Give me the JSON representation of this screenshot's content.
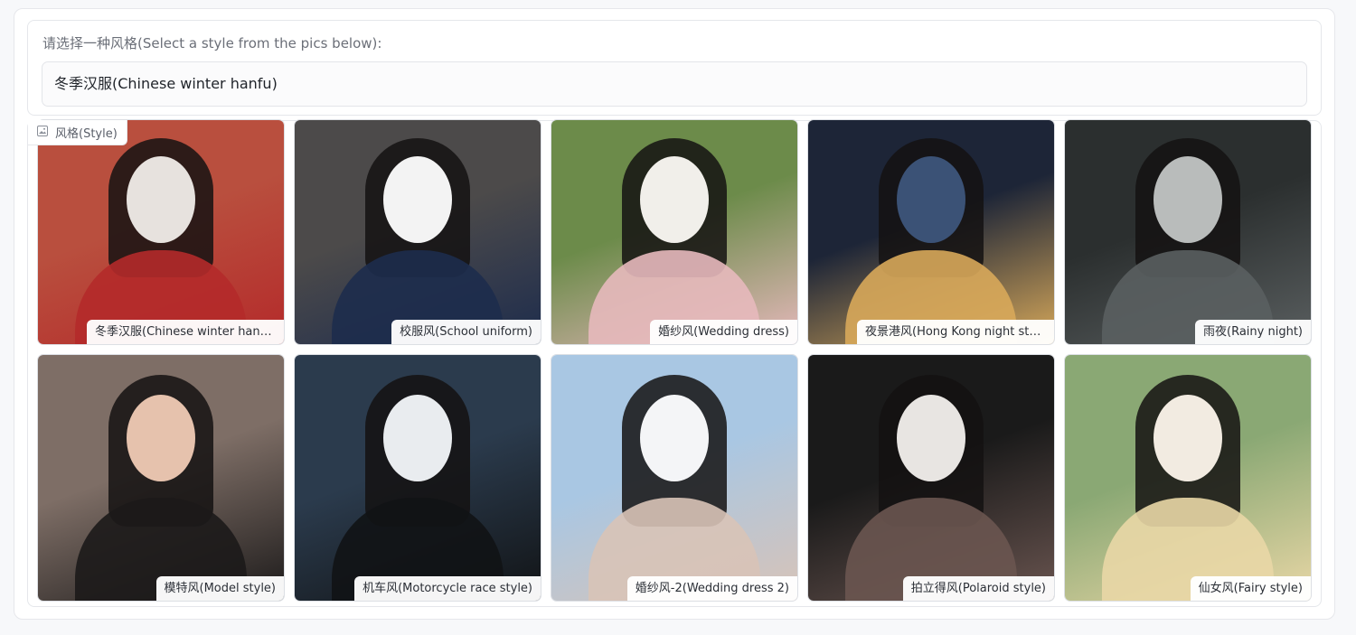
{
  "style_selector": {
    "label": "请选择一种风格(Select a style from the pics below):",
    "value": "冬季汉服(Chinese winter hanfu)"
  },
  "gallery": {
    "tag": "风格(Style)",
    "tag_icon": "image-icon",
    "items": [
      {
        "caption": "冬季汉服(Chinese winter hanfu)",
        "colors": [
          "#b94f3e",
          "#e7e2de",
          "#b42a2a"
        ]
      },
      {
        "caption": "校服风(School uniform)",
        "colors": [
          "#4c4a4a",
          "#f3f3f3",
          "#1d2c4d"
        ]
      },
      {
        "caption": "婚纱风(Wedding dress)",
        "colors": [
          "#6c8b4a",
          "#f1efea",
          "#e7b9bd"
        ]
      },
      {
        "caption": "夜景港风(Hong Kong night style)",
        "colors": [
          "#1d2537",
          "#3b5276",
          "#d8a95a"
        ]
      },
      {
        "caption": "雨夜(Rainy night)",
        "colors": [
          "#2b2f2f",
          "#b9bcbb",
          "#5a5f60"
        ]
      },
      {
        "caption": "模特风(Model style)",
        "colors": [
          "#7e6e66",
          "#e6c2ad",
          "#1c1a1a"
        ]
      },
      {
        "caption": "机车风(Motorcycle race style)",
        "colors": [
          "#2b3b4d",
          "#e9ecef",
          "#111315"
        ]
      },
      {
        "caption": "婚纱风-2(Wedding dress 2)",
        "colors": [
          "#a9c7e3",
          "#f4f5f7",
          "#d8c3b7"
        ]
      },
      {
        "caption": "拍立得风(Polaroid style)",
        "colors": [
          "#1a1a1a",
          "#e8e5e2",
          "#6a5550"
        ]
      },
      {
        "caption": "仙女风(Fairy style)",
        "colors": [
          "#8aa874",
          "#f2ebe1",
          "#e9d7a6"
        ]
      }
    ]
  }
}
